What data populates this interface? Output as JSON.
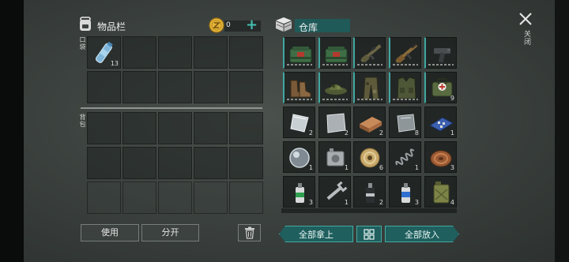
{
  "inventory": {
    "title": "物品栏",
    "pocket_label": "口袋",
    "backpack_label": "背包"
  },
  "currency": {
    "amount": "0",
    "add_label": "+"
  },
  "warehouse": {
    "title": "仓库"
  },
  "close": {
    "label": "关闭"
  },
  "pocket_item": {
    "name": "water-bottle",
    "qty": "13"
  },
  "warehouse_items": [
    {
      "icon": "cash-bag-icon",
      "qty": ""
    },
    {
      "icon": "cash-bag-icon",
      "qty": ""
    },
    {
      "icon": "rifle-icon",
      "qty": ""
    },
    {
      "icon": "assault-rifle-icon",
      "qty": ""
    },
    {
      "icon": "pistol-icon",
      "qty": ""
    },
    {
      "icon": "boots-icon",
      "qty": ""
    },
    {
      "icon": "camo-hat-icon",
      "qty": ""
    },
    {
      "icon": "camo-pants-icon",
      "qty": ""
    },
    {
      "icon": "tactical-vest-icon",
      "qty": ""
    },
    {
      "icon": "medical-bag-icon",
      "qty": "9"
    },
    {
      "icon": "glass-shard-icon",
      "qty": "2"
    },
    {
      "icon": "metal-sheet-icon",
      "qty": "2"
    },
    {
      "icon": "copper-bar-icon",
      "qty": "2"
    },
    {
      "icon": "iron-ingot-icon",
      "qty": "8"
    },
    {
      "icon": "circuit-board-icon",
      "qty": "1"
    },
    {
      "icon": "lens-icon",
      "qty": "1"
    },
    {
      "icon": "engine-part-icon",
      "qty": "1"
    },
    {
      "icon": "wire-spool-icon",
      "qty": "6"
    },
    {
      "icon": "spring-icon",
      "qty": "1"
    },
    {
      "icon": "rope-coil-icon",
      "qty": "3"
    },
    {
      "icon": "spray-can-green-icon",
      "qty": "3"
    },
    {
      "icon": "wrench-icon",
      "qty": "1"
    },
    {
      "icon": "spray-can-dark-icon",
      "qty": "2"
    },
    {
      "icon": "spray-can-blue-icon",
      "qty": "3"
    },
    {
      "icon": "jerry-can-icon",
      "qty": "4"
    }
  ],
  "buttons": {
    "use": "使用",
    "split": "分开",
    "take_all": "全部拿上",
    "put_all": "全部放入"
  },
  "colors": {
    "accent": "#3fa7a0",
    "teal_button": "#1f5f5e",
    "coin": "#e5b53a"
  }
}
